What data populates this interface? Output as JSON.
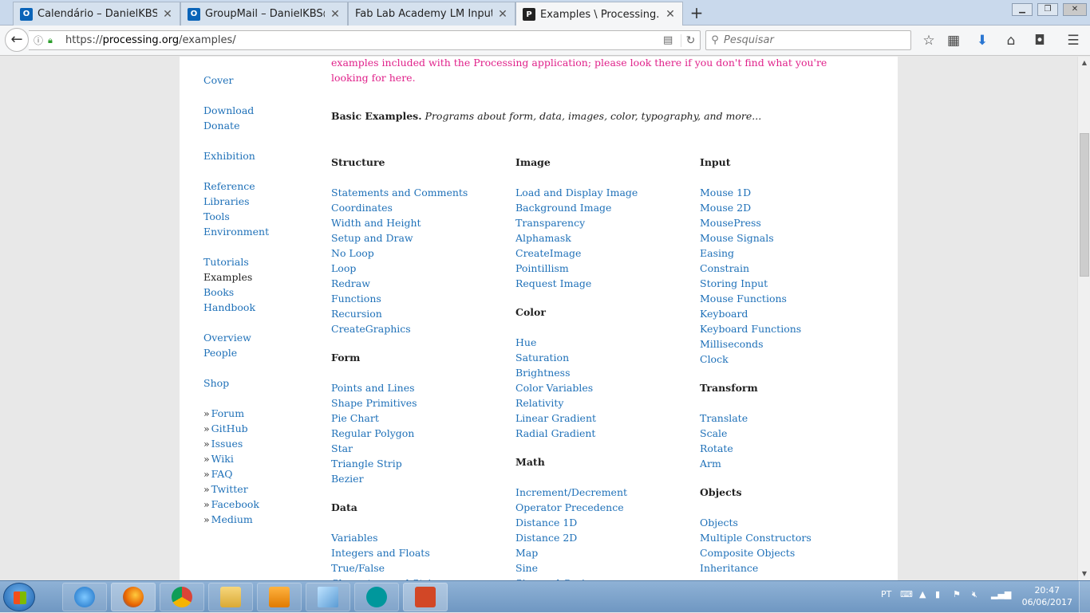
{
  "tabs": [
    {
      "title": "Calendário – DanielKBS@insp",
      "icon": "outlook-icon"
    },
    {
      "title": "GroupMail – DanielKBS@insp",
      "icon": "outlook-icon"
    },
    {
      "title": "Fab Lab Academy LM Input Devic",
      "icon": "none"
    },
    {
      "title": "Examples \\ Processing.org",
      "icon": "processing-icon"
    }
  ],
  "new_tab_label": "+",
  "address": {
    "domain": "processing.org",
    "scheme": "https://",
    "path": "/examples/"
  },
  "search": {
    "placeholder": "Pesquisar"
  },
  "sidebar": {
    "groups": [
      [
        {
          "label": "Cover"
        }
      ],
      [
        {
          "label": "Download"
        },
        {
          "label": "Donate"
        }
      ],
      [
        {
          "label": "Exhibition"
        }
      ],
      [
        {
          "label": "Reference"
        },
        {
          "label": "Libraries"
        },
        {
          "label": "Tools"
        },
        {
          "label": "Environment"
        }
      ],
      [
        {
          "label": "Tutorials"
        },
        {
          "label": "Examples",
          "current": true
        },
        {
          "label": "Books"
        },
        {
          "label": "Handbook"
        }
      ],
      [
        {
          "label": "Overview"
        },
        {
          "label": "People"
        }
      ],
      [
        {
          "label": "Shop"
        }
      ]
    ],
    "external": [
      "Forum",
      "GitHub",
      "Issues",
      "Wiki",
      "FAQ",
      "Twitter",
      "Facebook",
      "Medium"
    ],
    "raquo": "»"
  },
  "intro_text": "examples included with the Processing application; please look there if you don't find what you're looking for here.",
  "basic": {
    "title": "Basic Examples.",
    "subtitle": "Programs about form, data, images, color, typography, and more..."
  },
  "columns": [
    [
      {
        "title": "Structure",
        "items": [
          "Statements and Comments",
          "Coordinates",
          "Width and Height",
          "Setup and Draw",
          "No Loop",
          "Loop",
          "Redraw",
          "Functions",
          "Recursion",
          "CreateGraphics"
        ]
      },
      {
        "title": "Form",
        "items": [
          "Points and Lines",
          "Shape Primitives",
          "Pie Chart",
          "Regular Polygon",
          "Star",
          "Triangle Strip",
          "Bezier"
        ]
      },
      {
        "title": "Data",
        "items": [
          "Variables",
          "Integers and Floats",
          "True/False",
          "Characters and Strings"
        ]
      }
    ],
    [
      {
        "title": "Image",
        "items": [
          "Load and Display Image",
          "Background Image",
          "Transparency",
          "Alphamask",
          "CreateImage",
          "Pointillism",
          "Request Image"
        ]
      },
      {
        "title": "Color",
        "items": [
          "Hue",
          "Saturation",
          "Brightness",
          "Color Variables",
          "Relativity",
          "Linear Gradient",
          "Radial Gradient"
        ]
      },
      {
        "title": "Math",
        "items": [
          "Increment/Decrement",
          "Operator Precedence",
          "Distance 1D",
          "Distance 2D",
          "Map",
          "Sine",
          "Sine and Cosine"
        ]
      }
    ],
    [
      {
        "title": "Input",
        "items": [
          "Mouse 1D",
          "Mouse 2D",
          "MousePress",
          "Mouse Signals",
          "Easing",
          "Constrain",
          "Storing Input",
          "Mouse Functions",
          "Keyboard",
          "Keyboard Functions",
          "Milliseconds",
          "Clock"
        ]
      },
      {
        "title": "Transform",
        "items": [
          "Translate",
          "Scale",
          "Rotate",
          "Arm"
        ]
      },
      {
        "title": "Objects",
        "items": [
          "Objects",
          "Multiple Constructors",
          "Composite Objects",
          "Inheritance"
        ]
      }
    ]
  ],
  "taskbar": {
    "apps": [
      "internet-explorer-icon",
      "firefox-icon",
      "chrome-icon",
      "file-explorer-icon",
      "media-player-icon",
      "notepad-icon",
      "arduino-icon",
      "powerpoint-icon"
    ],
    "language": "PT",
    "time": "20:47",
    "date": "06/06/2017"
  },
  "colors": {
    "link": "#1e70b8",
    "intro": "#e0218a",
    "taskbar": "#7fa4cc"
  }
}
